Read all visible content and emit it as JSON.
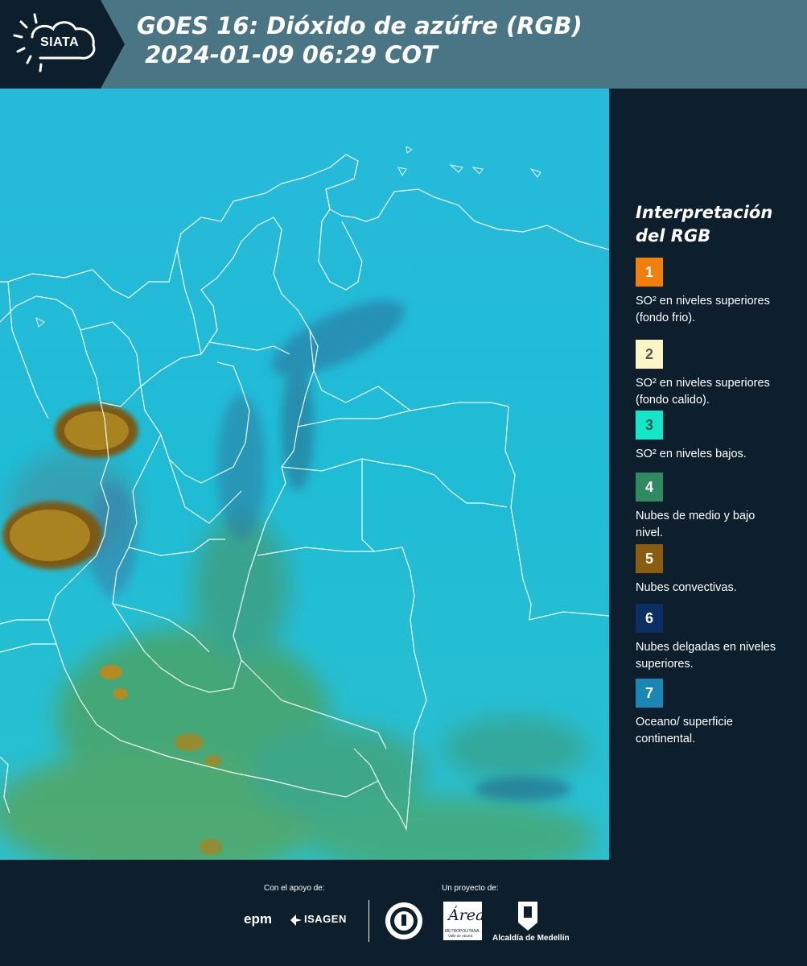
{
  "header": {
    "logo_text": "SIATA",
    "title": "GOES 16: Dióxido de azúfre (RGB)\n 2024-01-09 06:29 COT"
  },
  "legend": {
    "title": "Interpretación del RGB",
    "items": [
      {
        "number": "1",
        "label": "SO² en niveles superiores (fondo frio).",
        "color": "#f07f0e",
        "text_color": "#ffffff"
      },
      {
        "number": "2",
        "label": "SO² en niveles superiores (fondo calido).",
        "color": "#fcf5c6",
        "text_color": "#555555"
      },
      {
        "number": "3",
        "label": "SO² en niveles bajos.",
        "color": "#16e6c8",
        "text_color": "#2a5a55"
      },
      {
        "number": "4",
        "label": "Nubes de medio y bajo nivel.",
        "color": "#2f8a5f",
        "text_color": "#ffffff"
      },
      {
        "number": "5",
        "label": "Nubes convectivas.",
        "color": "#8a5c12",
        "text_color": "#ffffff"
      },
      {
        "number": "6",
        "label": "Nubes delgadas en niveles superiores.",
        "color": "#0c2f63",
        "text_color": "#ffffff"
      },
      {
        "number": "7",
        "label": "Oceano/ superficie continental.",
        "color": "#1a86b4",
        "text_color": "#ffffff"
      }
    ]
  },
  "footer": {
    "support_label": "Con el apoyo de:",
    "project_label": "Un proyecto de:",
    "partners": {
      "epm": "epm",
      "isagen": "ISAGEN",
      "area": "Área",
      "area_sub": "METROPOLITANA",
      "area_sub2": "Valle de Aburrá",
      "medellin": "Alcaldía de Medellín"
    }
  },
  "colors": {
    "ocean": "#22b8d8",
    "convective": "#a5811e",
    "low_clouds": "#4a9a5c",
    "header_bg": "#4a7585",
    "panel_bg": "#0d1f2d"
  }
}
